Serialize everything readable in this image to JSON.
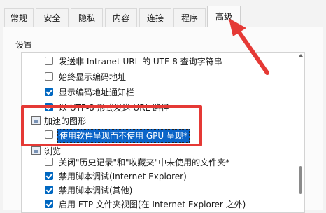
{
  "tabs": [
    "常规",
    "安全",
    "隐私",
    "内容",
    "连接",
    "程序",
    "高级"
  ],
  "active_tab": "高级",
  "section_title": "设置",
  "rows": [
    {
      "type": "checkbox",
      "checked": false,
      "label": "发送非 Intranet URL 的 UTF-8 查询字符串"
    },
    {
      "type": "checkbox",
      "checked": false,
      "label": "始终显示编码地址"
    },
    {
      "type": "checkbox",
      "checked": true,
      "label": "显示编码地址通知栏"
    },
    {
      "type": "checkbox",
      "checked": true,
      "label": "以 UTF-8 形式发送 URL 路径"
    },
    {
      "type": "group",
      "label": "加速的图形"
    },
    {
      "type": "checkbox",
      "checked": false,
      "label": "使用软件呈现而不使用 GPU 呈现*",
      "highlighted": true
    },
    {
      "type": "group",
      "label": "浏览"
    },
    {
      "type": "checkbox",
      "checked": false,
      "label": "关闭\"历史记录\"和\"收藏夹\"中未使用的文件夹*"
    },
    {
      "type": "checkbox",
      "checked": true,
      "label": "禁用脚本调试(Internet Explorer)"
    },
    {
      "type": "checkbox",
      "checked": true,
      "label": "禁用脚本调试(其他)"
    },
    {
      "type": "checkbox",
      "checked": true,
      "label": "启用 FTP 文件夹视图(在 Internet Explorer 之外)"
    }
  ],
  "annotation_color": "#e53935",
  "accent_color": "#0067c0"
}
